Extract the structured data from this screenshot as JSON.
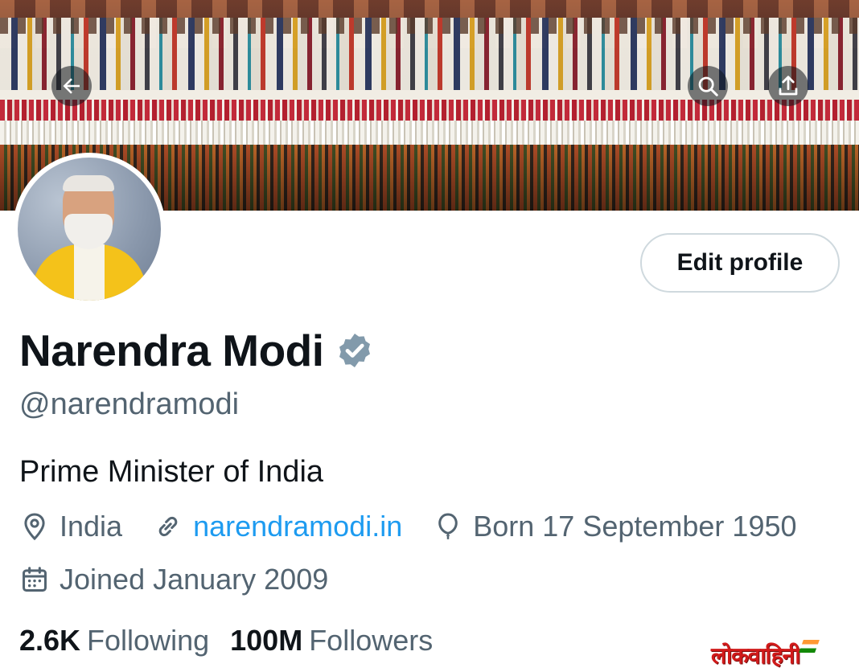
{
  "header": {
    "back_icon": "arrow-left-icon",
    "search_icon": "search-icon",
    "share_icon": "share-icon"
  },
  "profile": {
    "display_name": "Narendra Modi",
    "verified_badge_color": "#829aab",
    "handle": "@narendramodi",
    "bio": "Prime Minister of India",
    "edit_profile_label": "Edit profile",
    "location": "India",
    "website": "narendramodi.in",
    "birthday": "Born 17 September 1950",
    "joined": "Joined January 2009",
    "following_count": "2.6K",
    "following_label": "Following",
    "followers_count": "100M",
    "followers_label": "Followers"
  },
  "colors": {
    "link": "#1d9bf0",
    "muted_text": "#536471",
    "primary_text": "#0f1419"
  },
  "watermark": {
    "text": "लोकवाहिनी"
  }
}
